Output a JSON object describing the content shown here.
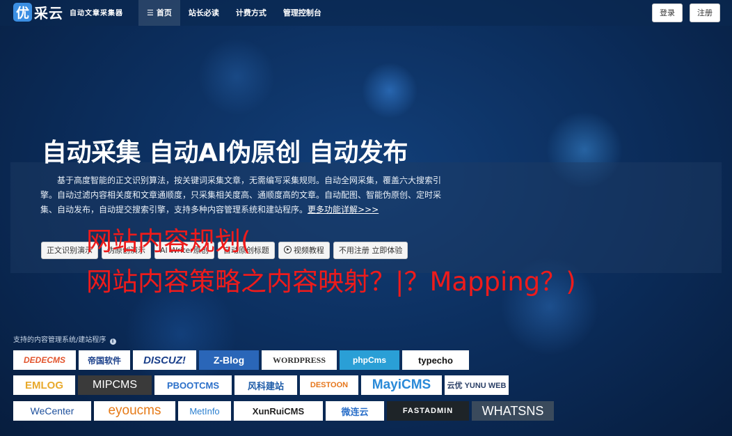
{
  "nav": {
    "logo_mark": "优",
    "logo_name": "采云",
    "logo_slogan": "自动文章采集器",
    "menu": [
      {
        "icon": "☰",
        "label": "首页"
      },
      {
        "label": "站长必读"
      },
      {
        "label": "计费方式"
      },
      {
        "label": "管理控制台"
      }
    ],
    "login": "登录",
    "register": "注册"
  },
  "hero": {
    "title": "自动采集 自动AI伪原创 自动发布",
    "description": "基于高度智能的正文识别算法，按关键词采集文章，无需编写采集规则。自动全网采集，覆盖六大搜索引擎。自动过滤内容相关度和文章通顺度，只采集相关度高、通顺度高的文章。自动配图、智能伪原创、定时采集、自动发布，自动提交搜索引擎，支持多种内容管理系统和建站程序。",
    "more_link": "更多功能详解>>>",
    "buttons": [
      "正文识别演示",
      "伪原创演示",
      "AI Writer原创",
      "自动原创标题",
      "视频教程",
      "不用注册 立即体验"
    ]
  },
  "overlay": {
    "line1": "网站内容规划(",
    "line2": "网站内容策略之内容映射？|？Mapping？)"
  },
  "cms": {
    "label": "支持的内容管理系统/建站程序",
    "rows": [
      [
        "DEDECMS",
        "帝国软件",
        "DISCUZ!",
        "Z-Blog",
        "WORDPRESS",
        "phpCms",
        "typecho"
      ],
      [
        "EMLOG",
        "MIPCMS",
        "PBOOTCMS",
        "风科建站",
        "DESTOON",
        "MayiCMS",
        "云优 YUNU WEB"
      ],
      [
        "WeCenter",
        "eyoucms",
        "MetInfo",
        "XunRuiCMS",
        "微连云",
        "FASTADMIN",
        "WHATSNS"
      ]
    ]
  },
  "colors": {
    "background": "#0b2c5a",
    "accent": "#3b8fe3",
    "overlay_text": "#ee1b1b"
  }
}
